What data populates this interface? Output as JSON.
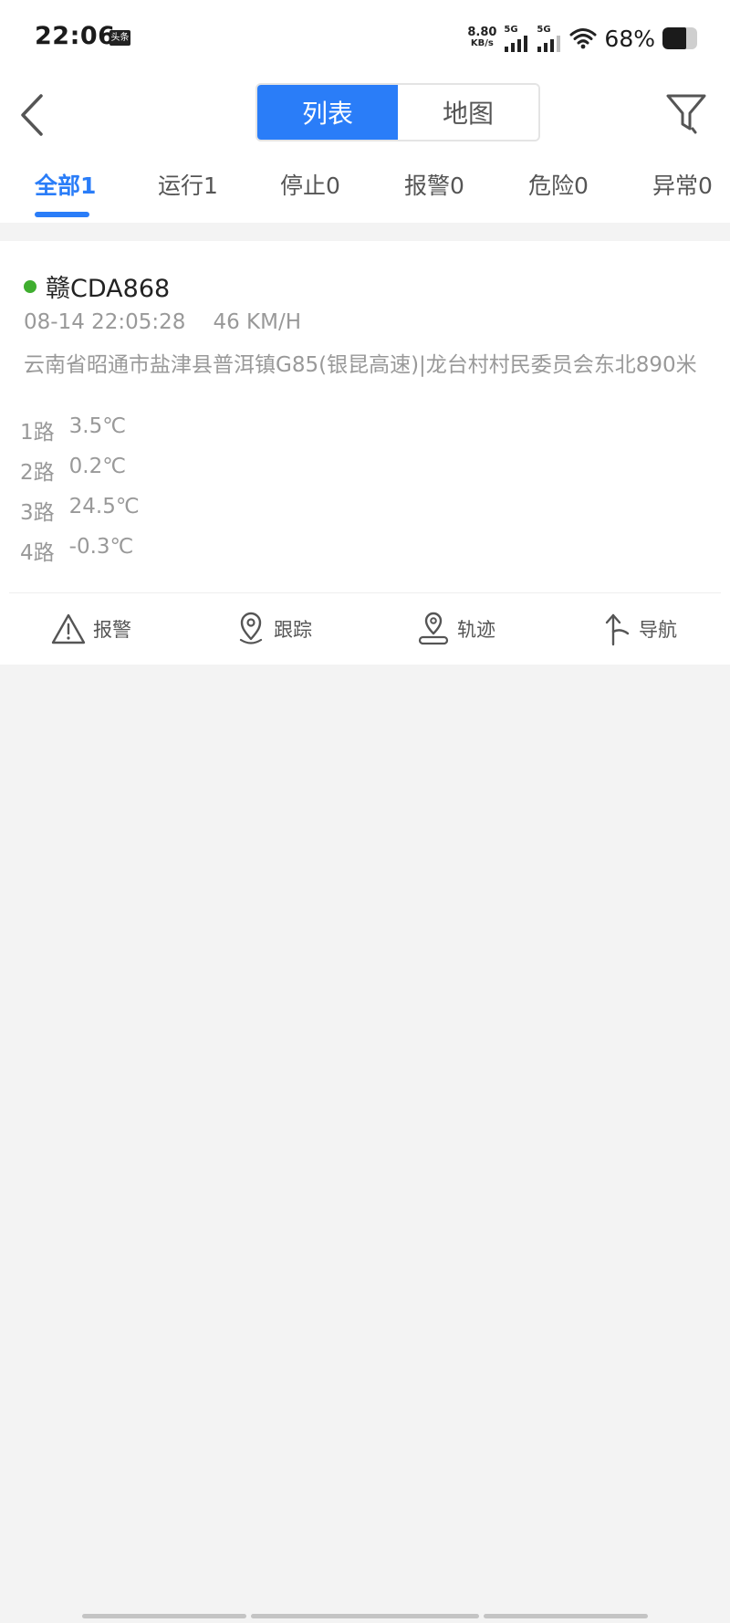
{
  "status_bar": {
    "time": "22:06",
    "notification_badge": "头条",
    "net_speed_value": "8.80",
    "net_speed_unit": "KB/s",
    "sim1_label": "5G",
    "sim2_label": "5G",
    "battery_percent": "68%",
    "battery_level": 0.68
  },
  "header": {
    "segments": [
      {
        "label": "列表",
        "active": true
      },
      {
        "label": "地图",
        "active": false
      }
    ],
    "icons": {
      "back": "chevron-left-icon",
      "filter": "filter-icon"
    }
  },
  "tabs": [
    {
      "label": "全部1",
      "active": true
    },
    {
      "label": "运行1",
      "active": false
    },
    {
      "label": "停止0",
      "active": false
    },
    {
      "label": "报警0",
      "active": false
    },
    {
      "label": "危险0",
      "active": false
    },
    {
      "label": "异常0",
      "active": false
    }
  ],
  "vehicle": {
    "plate": "赣CDA868",
    "status_color": "#3fae2f",
    "timestamp": "08-14 22:05:28",
    "speed": "46 KM/H",
    "address": "云南省昭通市盐津县普洱镇G85(银昆高速)|龙台村村民委员会东北890米",
    "temperatures": [
      {
        "channel": "1路",
        "value": "3.5℃"
      },
      {
        "channel": "2路",
        "value": "0.2℃"
      },
      {
        "channel": "3路",
        "value": "24.5℃"
      },
      {
        "channel": "4路",
        "value": "-0.3℃"
      }
    ],
    "actions": [
      {
        "label": "报警",
        "icon": "warning-triangle-icon"
      },
      {
        "label": "跟踪",
        "icon": "location-pin-icon"
      },
      {
        "label": "轨迹",
        "icon": "track-pin-icon"
      },
      {
        "label": "导航",
        "icon": "navigation-arrow-icon"
      }
    ]
  },
  "colors": {
    "accent": "#2a7df8",
    "running": "#3fae2f",
    "muted_text": "#999999",
    "background": "#f3f3f3"
  }
}
